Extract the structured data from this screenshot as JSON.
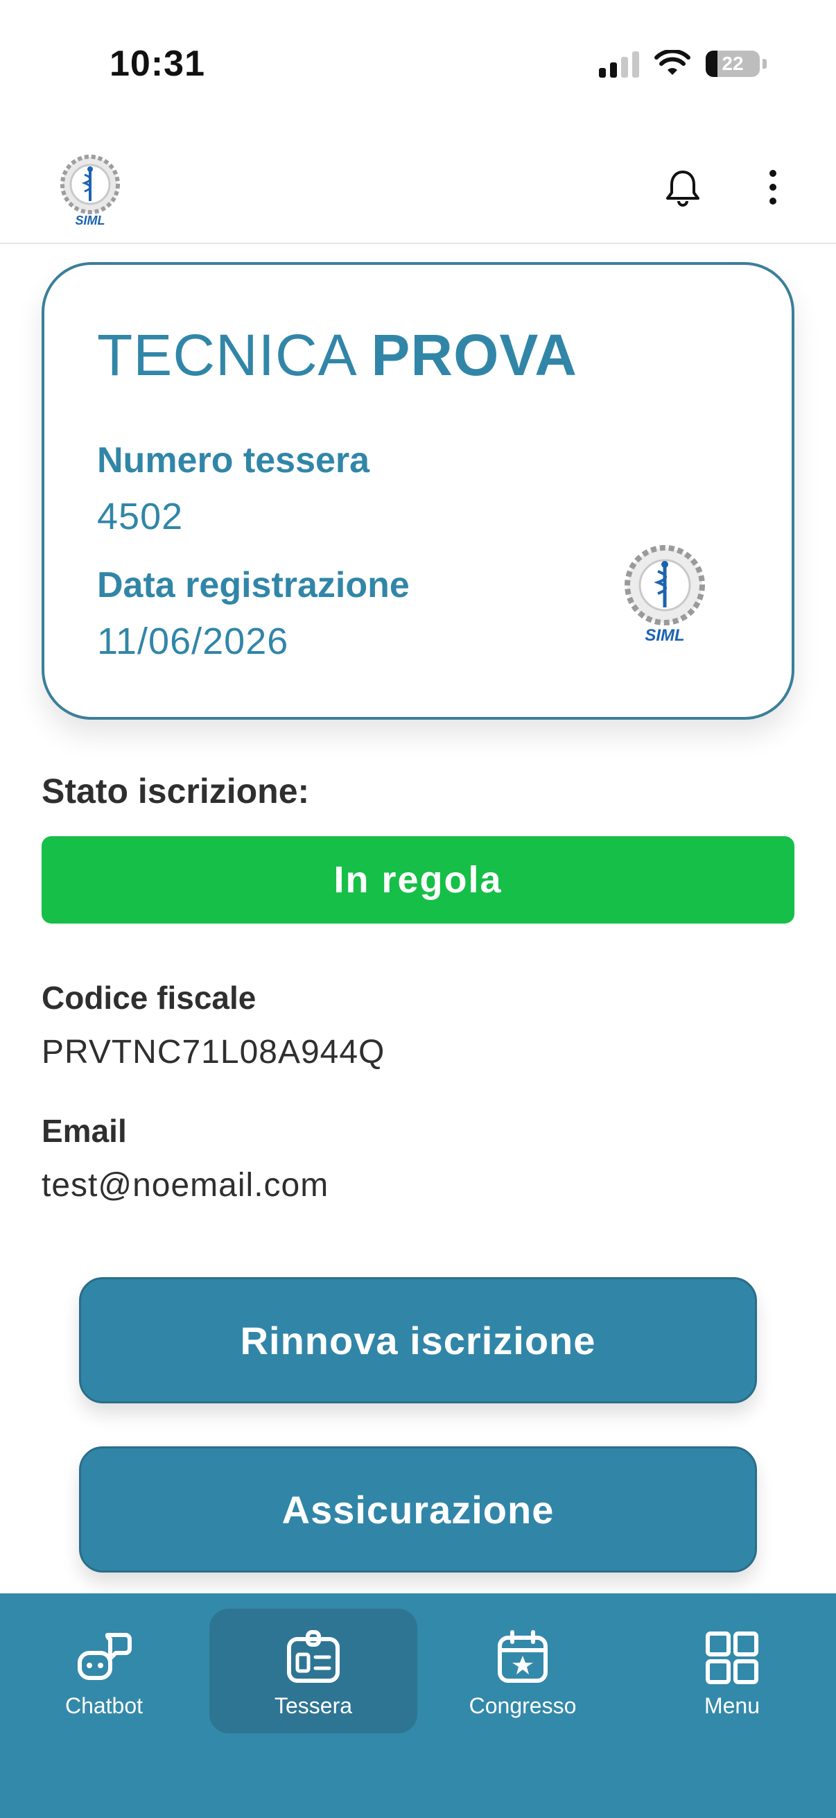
{
  "status_bar": {
    "time": "10:31",
    "battery_level": "22",
    "icons": [
      "cellular-signal-icon",
      "wifi-icon",
      "battery-icon"
    ]
  },
  "header": {
    "logo": "siml-logo",
    "icons": [
      "bell-icon",
      "more-vertical-icon"
    ]
  },
  "card": {
    "first_name": "TECNICA",
    "last_name": "PROVA",
    "member_number_label": "Numero tessera",
    "member_number": "4502",
    "registration_date_label": "Data registrazione",
    "registration_date": "11/06/2026",
    "logo": "siml-logo"
  },
  "membership": {
    "status_label": "Stato iscrizione:",
    "status_value": "In regola",
    "status_color": "#16bf47"
  },
  "profile": {
    "tax_code_label": "Codice fiscale",
    "tax_code": "PRVTNC71L08A944Q",
    "email_label": "Email",
    "email": "test@noemail.com"
  },
  "actions": {
    "renew_label": "Rinnova iscrizione",
    "insurance_label": "Assicurazione"
  },
  "bottom_nav": {
    "items": [
      {
        "label": "Chatbot",
        "icon": "chatbot-icon",
        "active": false
      },
      {
        "label": "Tessera",
        "icon": "id-card-icon",
        "active": true
      },
      {
        "label": "Congresso",
        "icon": "calendar-star-icon",
        "active": false
      },
      {
        "label": "Menu",
        "icon": "grid-icon",
        "active": false
      }
    ]
  },
  "colors": {
    "primary": "#3186a8",
    "nav_background": "#3389a9",
    "status_ok": "#16bf47"
  }
}
